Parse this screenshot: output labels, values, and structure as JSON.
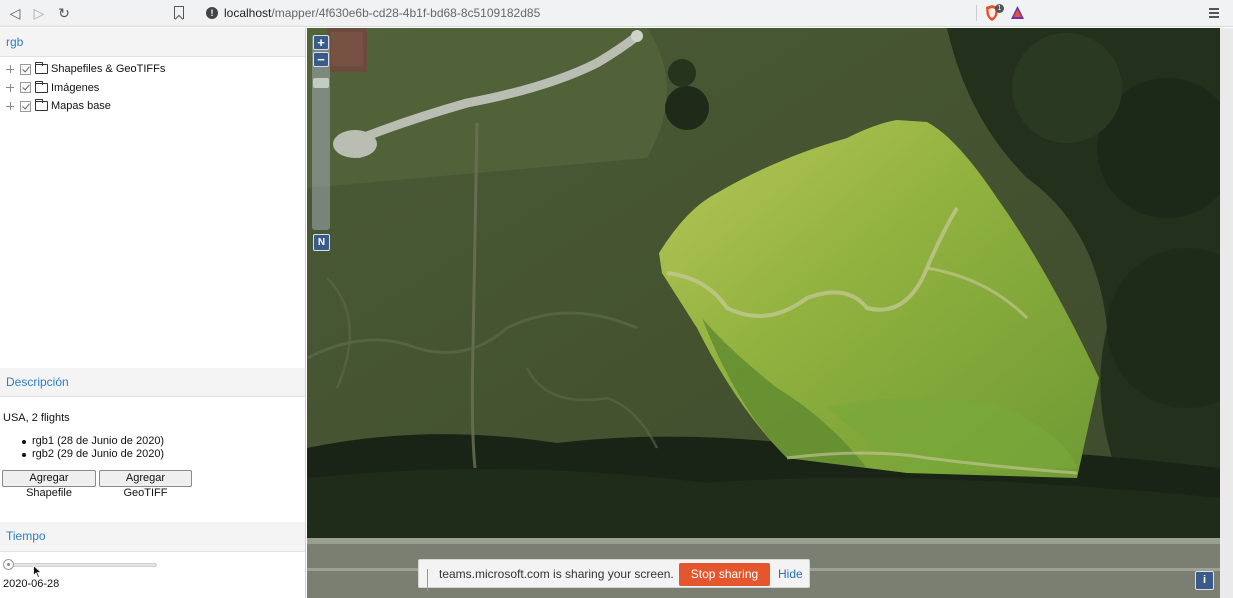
{
  "browser": {
    "url_host": "localhost",
    "url_path": "/mapper/4f630e6b-cd28-4b1f-bd68-8c5109182d85",
    "shield_badge": "1",
    "icons": [
      "back-icon",
      "forward-icon",
      "reload-icon",
      "bookmark-icon",
      "info-icon",
      "brave-shield-icon",
      "brave-rewards-icon",
      "menu-icon"
    ]
  },
  "left_panel": {
    "layers_title": "rgb",
    "tree": [
      {
        "label": "Shapefiles & GeoTIFFs",
        "checked": true
      },
      {
        "label": "Imágenes",
        "checked": true
      },
      {
        "label": "Mapas base",
        "checked": true
      }
    ],
    "description_title": "Descripción",
    "description_text": "USA, 2 flights",
    "flights": [
      "rgb1 (28 de Junio de 2020)",
      "rgb2 (29 de Junio de 2020)"
    ],
    "buttons": {
      "add_shapefile": "Agregar Shapefile",
      "add_geotiff": "Agregar GeoTIFF"
    },
    "time_title": "Tiempo",
    "time_slider_position": 0,
    "date_label": "2020-06-28"
  },
  "map": {
    "zoom_in": "+",
    "zoom_out": "−",
    "north": "N",
    "info": "i",
    "colors": {
      "background_satellite": "#3a4630",
      "field_overlay": "#9fbf3a",
      "nav_button": "#3a5a8a"
    }
  },
  "share_bar": {
    "message": "teams.microsoft.com is sharing your screen.",
    "stop_label": "Stop sharing",
    "hide_label": "Hide",
    "stop_color": "#e4572e"
  }
}
